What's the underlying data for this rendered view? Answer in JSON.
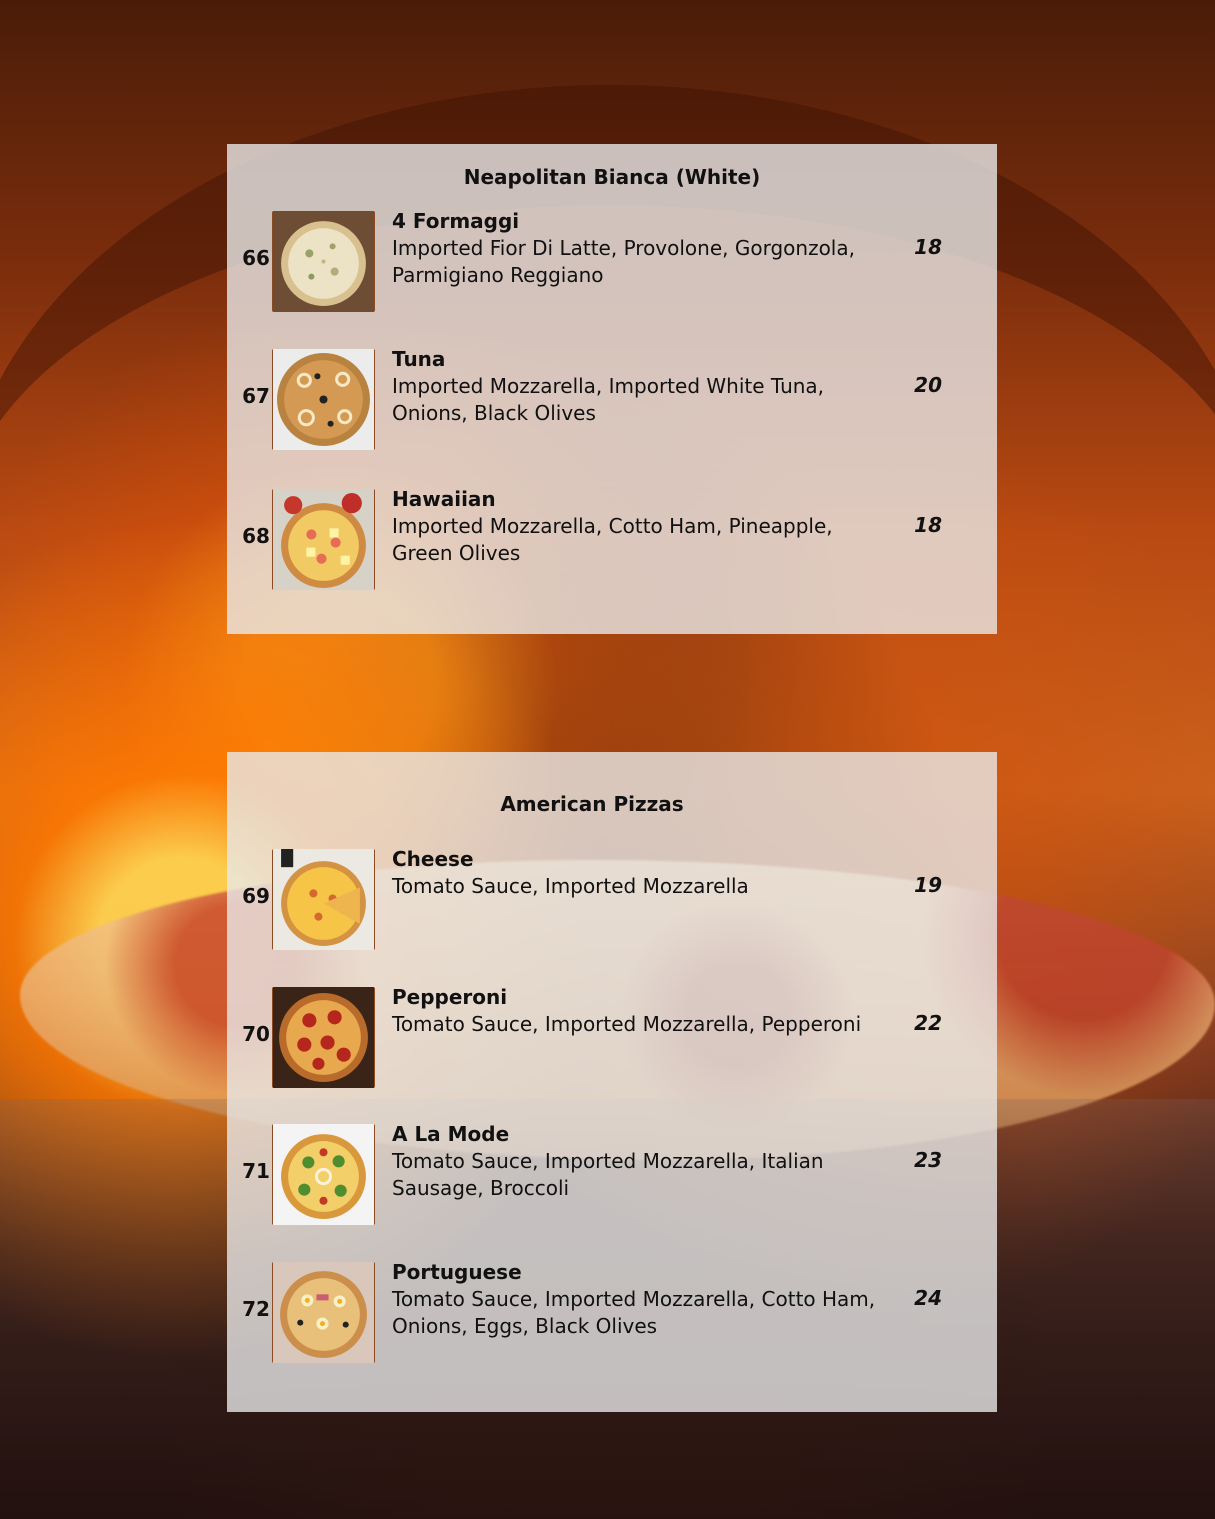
{
  "sections": [
    {
      "title": "Neapolitan Bianca (White)",
      "items": [
        {
          "number": "66",
          "name": "4 Formaggi",
          "description": "Imported Fior Di Latte, Provolone, Gorgonzola, Parmigiano Reggiano",
          "price": "18",
          "image": "white-cheese-pizza"
        },
        {
          "number": "67",
          "name": "Tuna",
          "description": "Imported Mozzarella, Imported White Tuna, Onions, Black Olives",
          "price": "20",
          "image": "tuna-onion-olive-pizza"
        },
        {
          "number": "68",
          "name": "Hawaiian",
          "description": "Imported Mozzarella, Cotto Ham, Pineapple, Green Olives",
          "price": "18",
          "image": "hawaiian-pizza"
        }
      ]
    },
    {
      "title": "American Pizzas",
      "items": [
        {
          "number": "69",
          "name": "Cheese",
          "description": "Tomato Sauce, Imported Mozzarella",
          "price": "19",
          "image": "cheese-pizza"
        },
        {
          "number": "70",
          "name": "Pepperoni",
          "description": "Tomato Sauce, Imported Mozzarella, Pepperoni",
          "price": "22",
          "image": "pepperoni-pizza"
        },
        {
          "number": "71",
          "name": "A La Mode",
          "description": "Tomato Sauce, Imported Mozzarella, Italian Sausage, Broccoli",
          "price": "23",
          "image": "broccoli-onion-pizza"
        },
        {
          "number": "72",
          "name": "Portuguese",
          "description": "Tomato Sauce, Imported Mozzarella, Cotto Ham, Onions, Eggs, Black Olives",
          "price": "24",
          "image": "portuguese-pizza"
        }
      ]
    }
  ],
  "colors": {
    "panel": "#e9e9e9",
    "fire": "#c9631f",
    "text": "#111111"
  }
}
